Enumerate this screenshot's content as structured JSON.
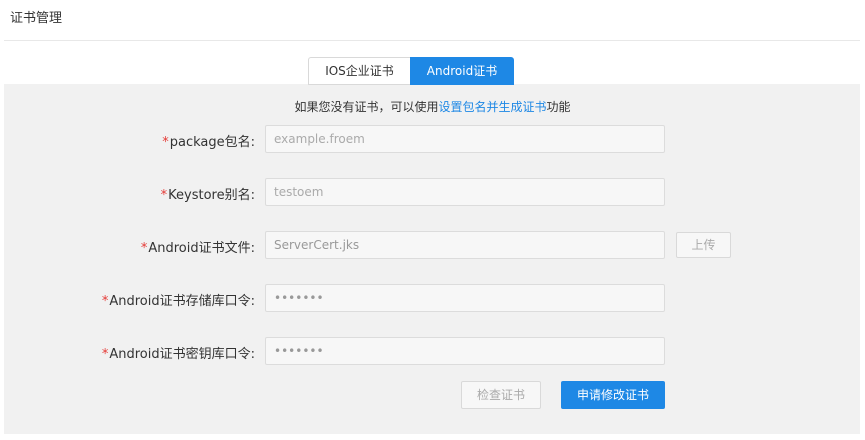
{
  "header": {
    "title": "证书管理"
  },
  "tabs": [
    {
      "label": "IOS企业证书",
      "active": false
    },
    {
      "label": "Android证书",
      "active": true
    }
  ],
  "hint": {
    "prefix": "如果您没有证书，可以使用",
    "link": "设置包名并生成证书",
    "suffix": "功能"
  },
  "form": {
    "required_mark": "*",
    "package": {
      "label": "package包名:",
      "placeholder": "example.froem"
    },
    "keystore": {
      "label": "Keystore别名:",
      "placeholder": "testoem"
    },
    "cert_file": {
      "label": "Android证书文件:",
      "value": "ServerCert.jks"
    },
    "store_password": {
      "label": "Android证书存储库口令:",
      "value": "•••••••"
    },
    "key_password": {
      "label": "Android证书密钥库口令:",
      "value": "•••••••"
    }
  },
  "buttons": {
    "upload": "上传",
    "check": "检查证书",
    "submit": "申请修改证书"
  },
  "colors": {
    "accent": "#1e88e5",
    "required": "#e53935",
    "panel": "#f1f1f1"
  }
}
